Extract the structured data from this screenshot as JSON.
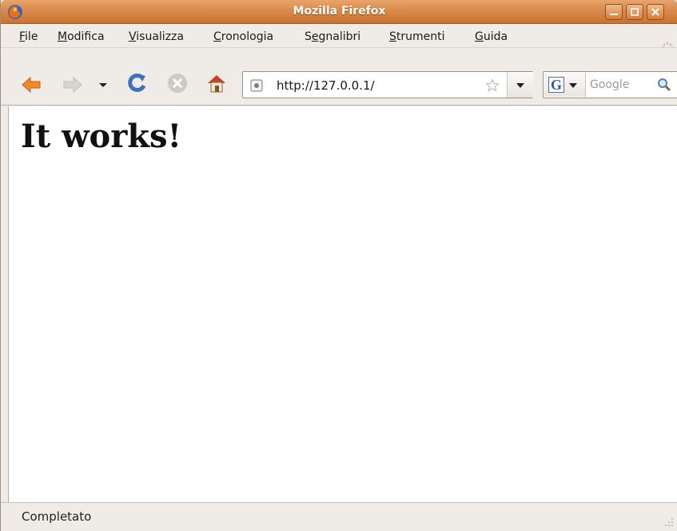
{
  "window": {
    "title": "Mozilla Firefox",
    "accent_color": "#d98a4a"
  },
  "menubar": {
    "items": [
      {
        "prefix": "",
        "accel": "F",
        "rest": "ile",
        "label": "File"
      },
      {
        "prefix": "",
        "accel": "M",
        "rest": "odifica",
        "label": "Modifica"
      },
      {
        "prefix": "",
        "accel": "V",
        "rest": "isualizza",
        "label": "Visualizza"
      },
      {
        "prefix": "",
        "accel": "C",
        "rest": "ronologia",
        "label": "Cronologia"
      },
      {
        "prefix": "S",
        "accel": "e",
        "rest": "gnalibri",
        "label": "Segnalibri"
      },
      {
        "prefix": "",
        "accel": "S",
        "rest": "trumenti",
        "label": "Strumenti"
      },
      {
        "prefix": "",
        "accel": "G",
        "rest": "uida",
        "label": "Guida"
      }
    ]
  },
  "toolbar": {
    "back_icon": "back-arrow-icon",
    "forward_icon": "forward-arrow-icon",
    "history_dropdown_icon": "chevron-down-icon",
    "reload_icon": "reload-icon",
    "stop_icon": "stop-icon",
    "home_icon": "home-icon"
  },
  "urlbar": {
    "value": "http://127.0.0.1/",
    "site_icon": "page-icon",
    "bookmark_icon": "star-icon"
  },
  "search": {
    "engine_letter": "G",
    "placeholder": "Google"
  },
  "page": {
    "heading": "It works!"
  },
  "status": {
    "text": "Completato"
  }
}
